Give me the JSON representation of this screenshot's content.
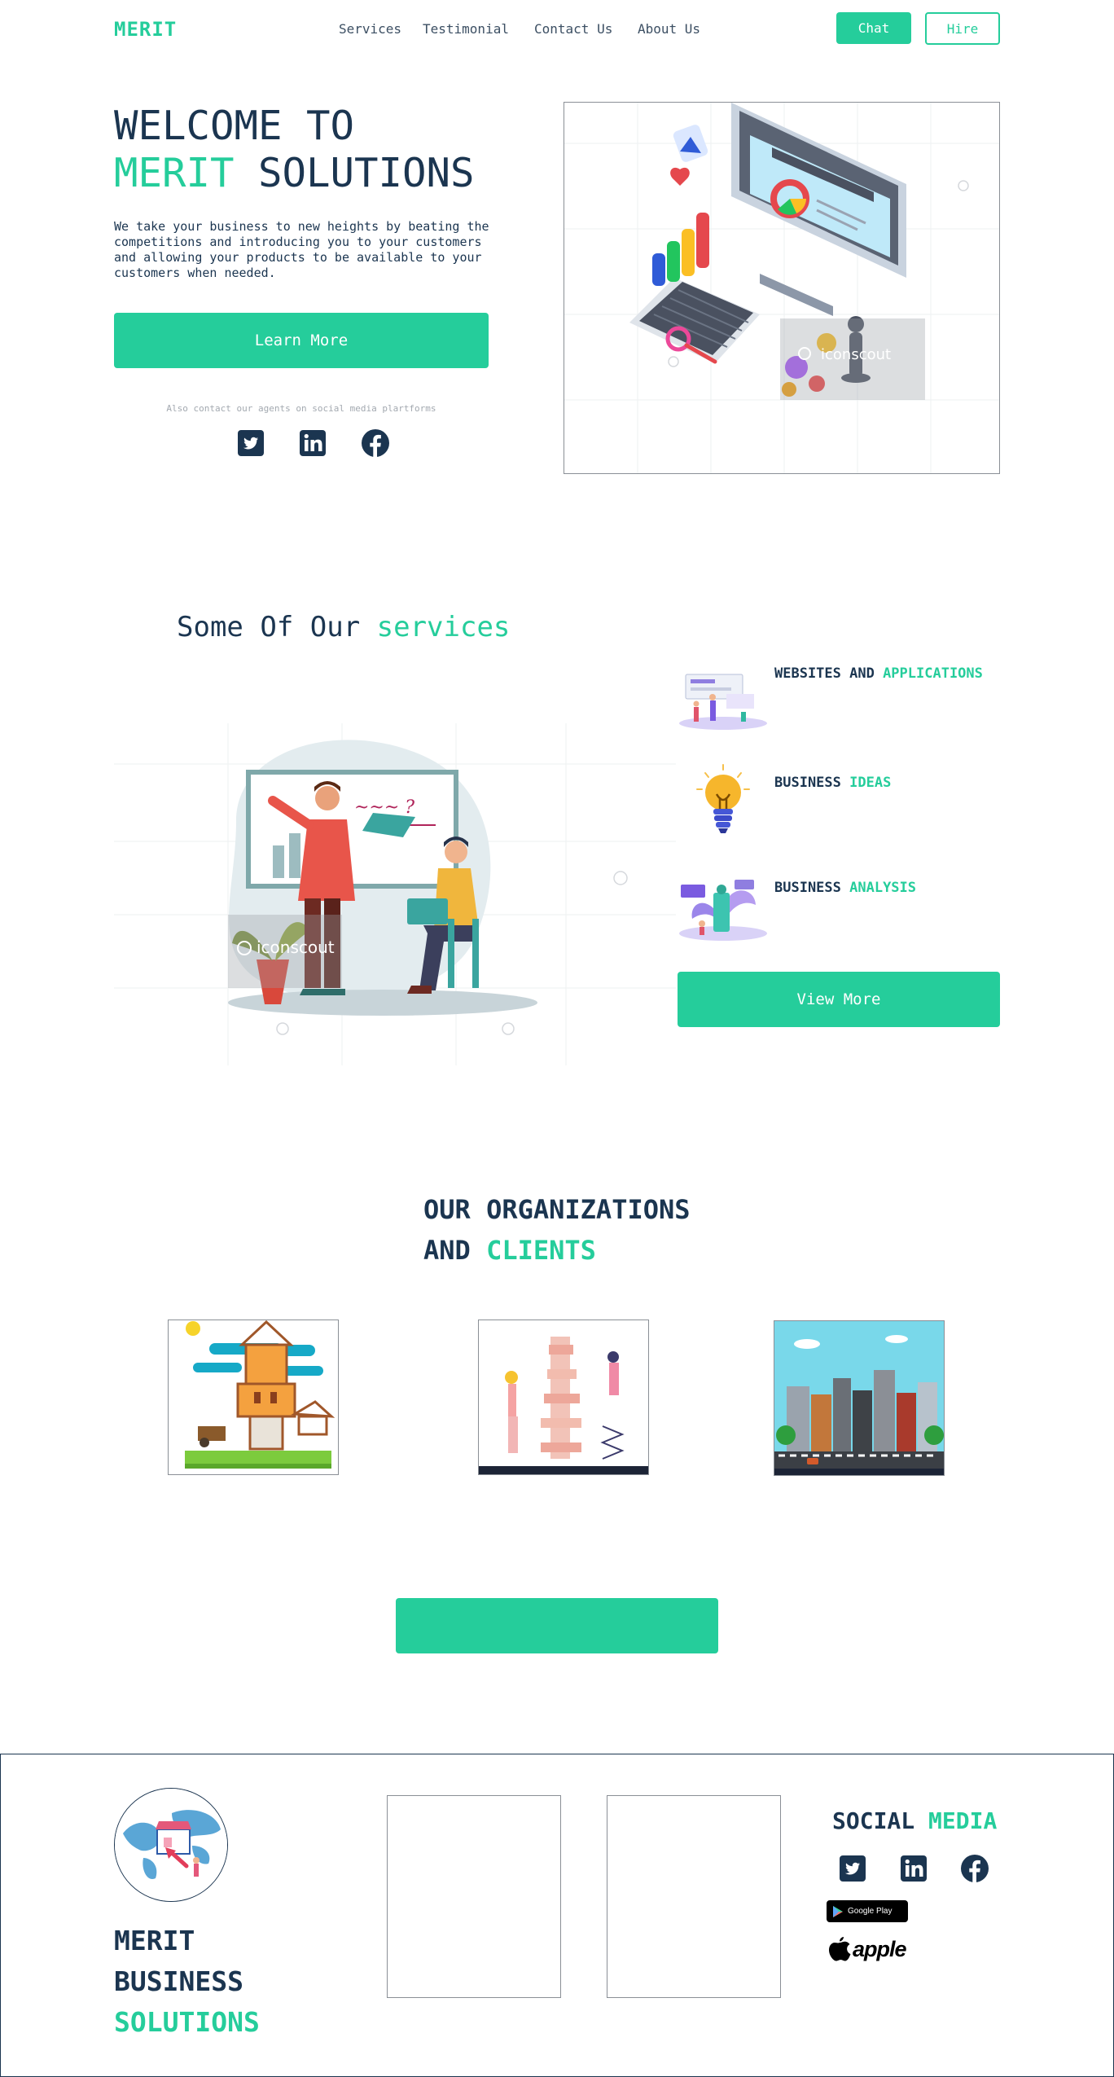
{
  "colors": {
    "accent": "#25cd9b",
    "navy": "#1b3550",
    "muted": "#a3a9b0"
  },
  "nav": {
    "logo": "MERIT",
    "links": [
      "Services",
      "Testimonial",
      "Contact Us",
      "About Us"
    ],
    "chat": "Chat",
    "hire": "Hire"
  },
  "hero": {
    "title_line1": "WELCOME TO",
    "title_accent": "MERIT",
    "title_rest": " SOLUTIONS",
    "description": "We take your business to new heights by beating the competitions and introducing you to your customers and allowing your products to be available to your customers when needed.",
    "learn_more": "Learn More",
    "social_note": "Also contact our agents on social media plartforms",
    "social_icons": [
      "twitter-icon",
      "linkedin-icon",
      "facebook-icon"
    ],
    "image_watermark": "iconscout"
  },
  "services": {
    "title_plain": "Some Of Our ",
    "title_accent": "services",
    "image_watermark": "iconscout",
    "items": [
      {
        "label_plain": "WEBSITES AND ",
        "label_accent": "APPLICATIONS"
      },
      {
        "label_plain": "BUSINESS ",
        "label_accent": "IDEAS"
      },
      {
        "label_plain": "BUSINESS ",
        "label_accent": "ANALYSIS"
      }
    ],
    "view_more": "View More"
  },
  "orgs": {
    "title_line1": "OUR ORGANIZATIONS",
    "title_plain": "AND ",
    "title_accent": "CLIENTS"
  },
  "footer": {
    "brand_line1": "MERIT",
    "brand_line2": "BUSINESS",
    "brand_line3": "SOLUTIONS",
    "social_plain": "SOCIAL ",
    "social_accent": "MEDIA",
    "google_play": "Google Play",
    "apple": "apple"
  }
}
